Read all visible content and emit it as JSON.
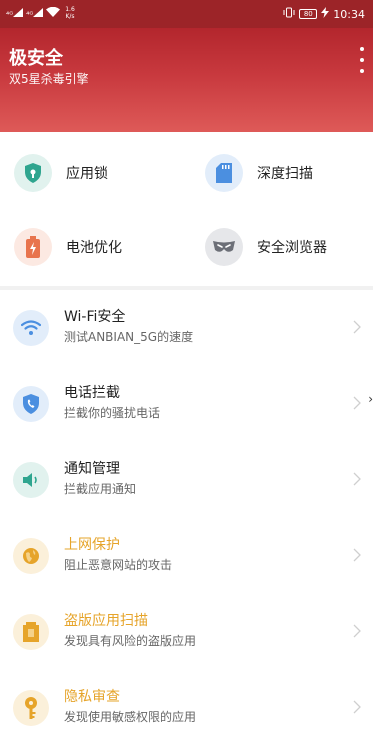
{
  "status_bar": {
    "signal_1": "⁴ᴳ",
    "signal_2": "⁴ᴳ",
    "speed_value": "1.6",
    "speed_unit": "K/s",
    "battery": "80",
    "time": "10:34"
  },
  "header": {
    "title": "极安全",
    "subtitle": "双5星杀毒引擎"
  },
  "grid": [
    {
      "label": "应用锁",
      "icon": "shield-lock-icon",
      "color": "#2fa58f"
    },
    {
      "label": "深度扫描",
      "icon": "sd-card-icon",
      "color": "#4b8fe0"
    },
    {
      "label": "电池优化",
      "icon": "battery-icon",
      "color": "#e8744d"
    },
    {
      "label": "安全浏览器",
      "icon": "browser-mask-icon",
      "color": "#6c6f77"
    }
  ],
  "list": [
    {
      "title": "Wi-Fi安全",
      "subtitle": "测试ANBIAN_5G的速度",
      "icon": "wifi-icon",
      "color": "#4b8fe0",
      "warn": false
    },
    {
      "title": "电话拦截",
      "subtitle": "拦截你的骚扰电话",
      "icon": "phone-shield-icon",
      "color": "#4b8fe0",
      "warn": false
    },
    {
      "title": "通知管理",
      "subtitle": "拦截应用通知",
      "icon": "speaker-icon",
      "color": "#2fa58f",
      "warn": false
    },
    {
      "title": "上网保护",
      "subtitle": "阻止恶意网站的攻击",
      "icon": "globe-icon",
      "color": "#e6a42a",
      "warn": true
    },
    {
      "title": "盗版应用扫描",
      "subtitle": "发现具有风险的盗版应用",
      "icon": "package-icon",
      "color": "#e6a42a",
      "warn": true
    },
    {
      "title": "隐私审查",
      "subtitle": "发现使用敏感权限的应用",
      "icon": "key-icon",
      "color": "#e6a42a",
      "warn": true
    }
  ],
  "edge_glyph": "›"
}
